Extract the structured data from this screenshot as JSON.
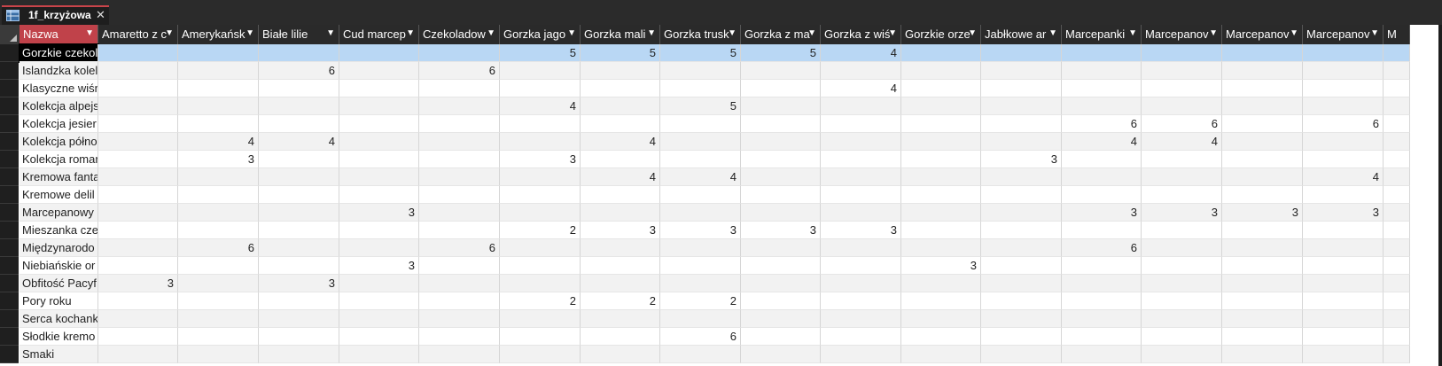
{
  "tab": {
    "title": "1f_krzyżowa",
    "close_label": "✕"
  },
  "columns": [
    "Nazwa",
    "Amaretto z c",
    "Amerykańsk",
    "Białe lilie",
    "Cud marcep",
    "Czekoladow",
    "Gorzka jago",
    "Gorzka mali",
    "Gorzka trusk",
    "Gorzka z ma",
    "Gorzka z wiś",
    "Gorzkie orze",
    "Jabłkowe ar",
    "Marcepanki",
    "Marcepanov",
    "Marcepanov",
    "Marcepanov",
    "M"
  ],
  "rows": [
    {
      "name": "Gorzkie czekol",
      "values": [
        "",
        "",
        "",
        "",
        "",
        "5",
        "5",
        "5",
        "5",
        "4",
        "",
        "",
        "",
        "",
        "",
        "",
        ""
      ]
    },
    {
      "name": "Islandzka kolel",
      "values": [
        "",
        "",
        "6",
        "",
        "6",
        "",
        "",
        "",
        "",
        "",
        "",
        "",
        "",
        "",
        "",
        "",
        ""
      ]
    },
    {
      "name": "Klasyczne wiśn",
      "values": [
        "",
        "",
        "",
        "",
        "",
        "",
        "",
        "",
        "",
        "4",
        "",
        "",
        "",
        "",
        "",
        "",
        ""
      ]
    },
    {
      "name": "Kolekcja alpejs",
      "values": [
        "",
        "",
        "",
        "",
        "",
        "4",
        "",
        "5",
        "",
        "",
        "",
        "",
        "",
        "",
        "",
        "",
        ""
      ]
    },
    {
      "name": "Kolekcja jesier",
      "values": [
        "",
        "",
        "",
        "",
        "",
        "",
        "",
        "",
        "",
        "",
        "",
        "",
        "6",
        "6",
        "",
        "6",
        ""
      ]
    },
    {
      "name": "Kolekcja półno",
      "values": [
        "",
        "4",
        "4",
        "",
        "",
        "",
        "4",
        "",
        "",
        "",
        "",
        "",
        "4",
        "4",
        "",
        "",
        ""
      ]
    },
    {
      "name": "Kolekcja romar",
      "values": [
        "",
        "3",
        "",
        "",
        "",
        "3",
        "",
        "",
        "",
        "",
        "",
        "3",
        "",
        "",
        "",
        "",
        ""
      ]
    },
    {
      "name": "Kremowa fanta",
      "values": [
        "",
        "",
        "",
        "",
        "",
        "",
        "4",
        "4",
        "",
        "",
        "",
        "",
        "",
        "",
        "",
        "4",
        ""
      ]
    },
    {
      "name": "Kremowe delil",
      "values": [
        "",
        "",
        "",
        "",
        "",
        "",
        "",
        "",
        "",
        "",
        "",
        "",
        "",
        "",
        "",
        "",
        ""
      ]
    },
    {
      "name": "Marcepanowy",
      "values": [
        "",
        "",
        "",
        "3",
        "",
        "",
        "",
        "",
        "",
        "",
        "",
        "",
        "3",
        "3",
        "3",
        "3",
        ""
      ]
    },
    {
      "name": "Mieszanka cze",
      "values": [
        "",
        "",
        "",
        "",
        "",
        "2",
        "3",
        "3",
        "3",
        "3",
        "",
        "",
        "",
        "",
        "",
        "",
        ""
      ]
    },
    {
      "name": "Międzynarodo",
      "values": [
        "",
        "6",
        "",
        "",
        "6",
        "",
        "",
        "",
        "",
        "",
        "",
        "",
        "6",
        "",
        "",
        "",
        ""
      ]
    },
    {
      "name": "Niebiańskie or",
      "values": [
        "",
        "",
        "",
        "3",
        "",
        "",
        "",
        "",
        "",
        "",
        "3",
        "",
        "",
        "",
        "",
        "",
        ""
      ]
    },
    {
      "name": "Obfitość Pacyf",
      "values": [
        "3",
        "",
        "3",
        "",
        "",
        "",
        "",
        "",
        "",
        "",
        "",
        "",
        "",
        "",
        "",
        "",
        ""
      ]
    },
    {
      "name": "Pory roku",
      "values": [
        "",
        "",
        "",
        "",
        "",
        "2",
        "2",
        "2",
        "",
        "",
        "",
        "",
        "",
        "",
        "",
        "",
        ""
      ]
    },
    {
      "name": "Serca kochank",
      "values": [
        "",
        "",
        "",
        "",
        "",
        "",
        "",
        "",
        "",
        "",
        "",
        "",
        "",
        "",
        "",
        "",
        ""
      ]
    },
    {
      "name": "Słodkie kremo",
      "values": [
        "",
        "",
        "",
        "",
        "",
        "",
        "",
        "6",
        "",
        "",
        "",
        "",
        "",
        "",
        "",
        "",
        ""
      ]
    },
    {
      "name": "Smaki",
      "values": [
        "",
        "",
        "",
        "",
        "",
        "",
        "",
        "",
        "",
        "",
        "",
        "",
        "",
        "",
        "",
        "",
        ""
      ]
    }
  ]
}
